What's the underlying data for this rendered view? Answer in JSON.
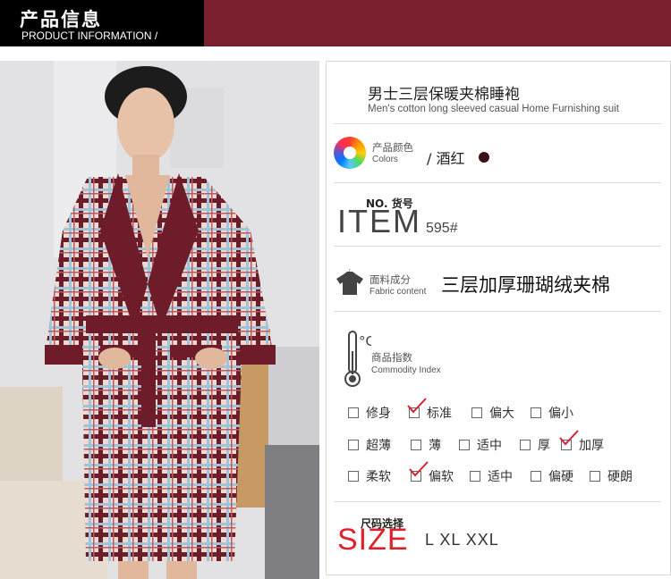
{
  "header": {
    "title_cn": "产品信息",
    "title_en": "PRODUCT INFORMATION /"
  },
  "product": {
    "name_cn": "男士三层保暖夹棉睡袍",
    "name_en": "Men's cotton long sleeved casual Home Furnishing suit"
  },
  "color": {
    "label_cn": "产品颜色",
    "label_en": "Colors",
    "value": "/ 酒红",
    "swatch": "#3a1216"
  },
  "item": {
    "label": "NO. 货号",
    "word": "ITEM",
    "number": "595#"
  },
  "fabric": {
    "label_cn": "面料成分",
    "label_en": "Fabric content",
    "value": "三层加厚珊瑚绒夹棉"
  },
  "index": {
    "label_cn": "商品指数",
    "label_en": "Commodity Index",
    "unit": "°C"
  },
  "index_rows": [
    [
      {
        "label": "修身",
        "checked": false
      },
      {
        "label": "标准",
        "checked": true
      },
      {
        "label": "偏大",
        "checked": false
      },
      {
        "label": "偏小",
        "checked": false
      }
    ],
    [
      {
        "label": "超薄",
        "checked": false
      },
      {
        "label": "薄",
        "checked": false
      },
      {
        "label": "适中",
        "checked": false
      },
      {
        "label": "厚",
        "checked": false
      },
      {
        "label": "加厚",
        "checked": true
      }
    ],
    [
      {
        "label": "柔软",
        "checked": false
      },
      {
        "label": "偏软",
        "checked": true
      },
      {
        "label": "适中",
        "checked": false
      },
      {
        "label": "偏硬",
        "checked": false
      },
      {
        "label": "硬朗",
        "checked": false
      }
    ]
  ],
  "size": {
    "label": "尺码选择",
    "word": "SIZE",
    "values": "L XL XXL"
  },
  "colors": {
    "brand": "#7a1f2e",
    "check": "#d9212e",
    "size_red": "#e0202a"
  }
}
